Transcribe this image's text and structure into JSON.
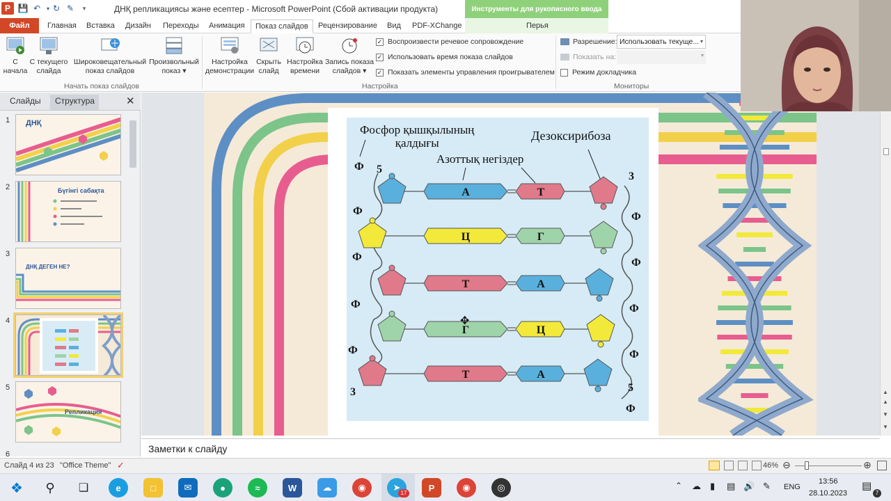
{
  "window": {
    "title": "ДНҚ репликациясы және есептер  -  Microsoft PowerPoint (Сбой активации продукта)",
    "ink_tools": "Инструменты для рукописного ввода"
  },
  "tabs": [
    {
      "label": "Файл"
    },
    {
      "label": "Главная"
    },
    {
      "label": "Вставка"
    },
    {
      "label": "Дизайн"
    },
    {
      "label": "Переходы"
    },
    {
      "label": "Анимация"
    },
    {
      "label": "Показ слайдов"
    },
    {
      "label": "Рецензирование"
    },
    {
      "label": "Вид"
    },
    {
      "label": "PDF-XChange"
    },
    {
      "label": "Перья"
    }
  ],
  "ribbon": {
    "start_group": {
      "label": "Начать показ слайдов",
      "from_start": [
        "С",
        "начала"
      ],
      "from_current": [
        "С текущего",
        "слайда"
      ],
      "broadcast": [
        "Широковещательный",
        "показ слайдов"
      ],
      "custom": [
        "Произвольный",
        "показ ▾"
      ]
    },
    "setup_group": {
      "label": "Настройка",
      "setup_show": [
        "Настройка",
        "демонстрации"
      ],
      "hide_slide": [
        "Скрыть",
        "слайд"
      ],
      "rehearse": [
        "Настройка",
        "времени"
      ],
      "record": [
        "Запись показа",
        "слайдов ▾"
      ],
      "checks": [
        {
          "label": "Воспроизвести речевое сопровождение",
          "checked": true
        },
        {
          "label": "Использовать время показа слайдов",
          "checked": true
        },
        {
          "label": "Показать элементы управления проигрывателем",
          "checked": true
        }
      ]
    },
    "monitors_group": {
      "label": "Мониторы",
      "resolution_label": "Разрешение:",
      "resolution_value": "Использовать текуще...",
      "show_on_label": "Показать на:",
      "presenter_view": "Режим докладчика"
    }
  },
  "left_pane": {
    "tab_slides": "Слайды",
    "tab_outline": "Структура",
    "slides": [
      {
        "num": "1",
        "title": "ДНҚ"
      },
      {
        "num": "2",
        "title": "Бүгінгі сабақта"
      },
      {
        "num": "3",
        "title": "ДНҚ ДЕГЕН НЕ?"
      },
      {
        "num": "4",
        "title": ""
      },
      {
        "num": "5",
        "title": "Репликация"
      },
      {
        "num": "6",
        "title": ""
      }
    ]
  },
  "slide": {
    "label_phosphate": [
      "Фосфор қышқылының",
      "қалдығы"
    ],
    "label_deoxyribose": "Дезоксирибоза",
    "label_bases": "Азоттық негіздер",
    "phi": "Ф",
    "five": "5",
    "three": "3",
    "pairs": [
      {
        "left": "А",
        "right": "Т",
        "left_color": "#5ab0dd",
        "right_color": "#e07a8a",
        "lsugar": "#5ab0dd",
        "rsugar": "#e07a8a"
      },
      {
        "left": "Ц",
        "right": "Г",
        "left_color": "#f2e93a",
        "right_color": "#9fd3a9",
        "lsugar": "#f2e93a",
        "rsugar": "#9fd3a9"
      },
      {
        "left": "Т",
        "right": "А",
        "left_color": "#e07a8a",
        "right_color": "#5ab0dd",
        "lsugar": "#e07a8a",
        "rsugar": "#5ab0dd"
      },
      {
        "left": "Г",
        "right": "Ц",
        "left_color": "#9fd3a9",
        "right_color": "#f2e93a",
        "lsugar": "#9fd3a9",
        "rsugar": "#f2e93a"
      },
      {
        "left": "Т",
        "right": "А",
        "left_color": "#e07a8a",
        "right_color": "#5ab0dd",
        "lsugar": "#e07a8a",
        "rsugar": "#5ab0dd"
      }
    ]
  },
  "notes": {
    "placeholder": "Заметки к слайду"
  },
  "status": {
    "slide_of": "Слайд 4 из 23",
    "theme": "\"Office Theme\"",
    "zoom": "46%"
  },
  "taskbar": {
    "lang": "ENG",
    "time": "13:56",
    "date": "28.10.2023",
    "telegram_badge": "17",
    "notif_count": "7"
  }
}
